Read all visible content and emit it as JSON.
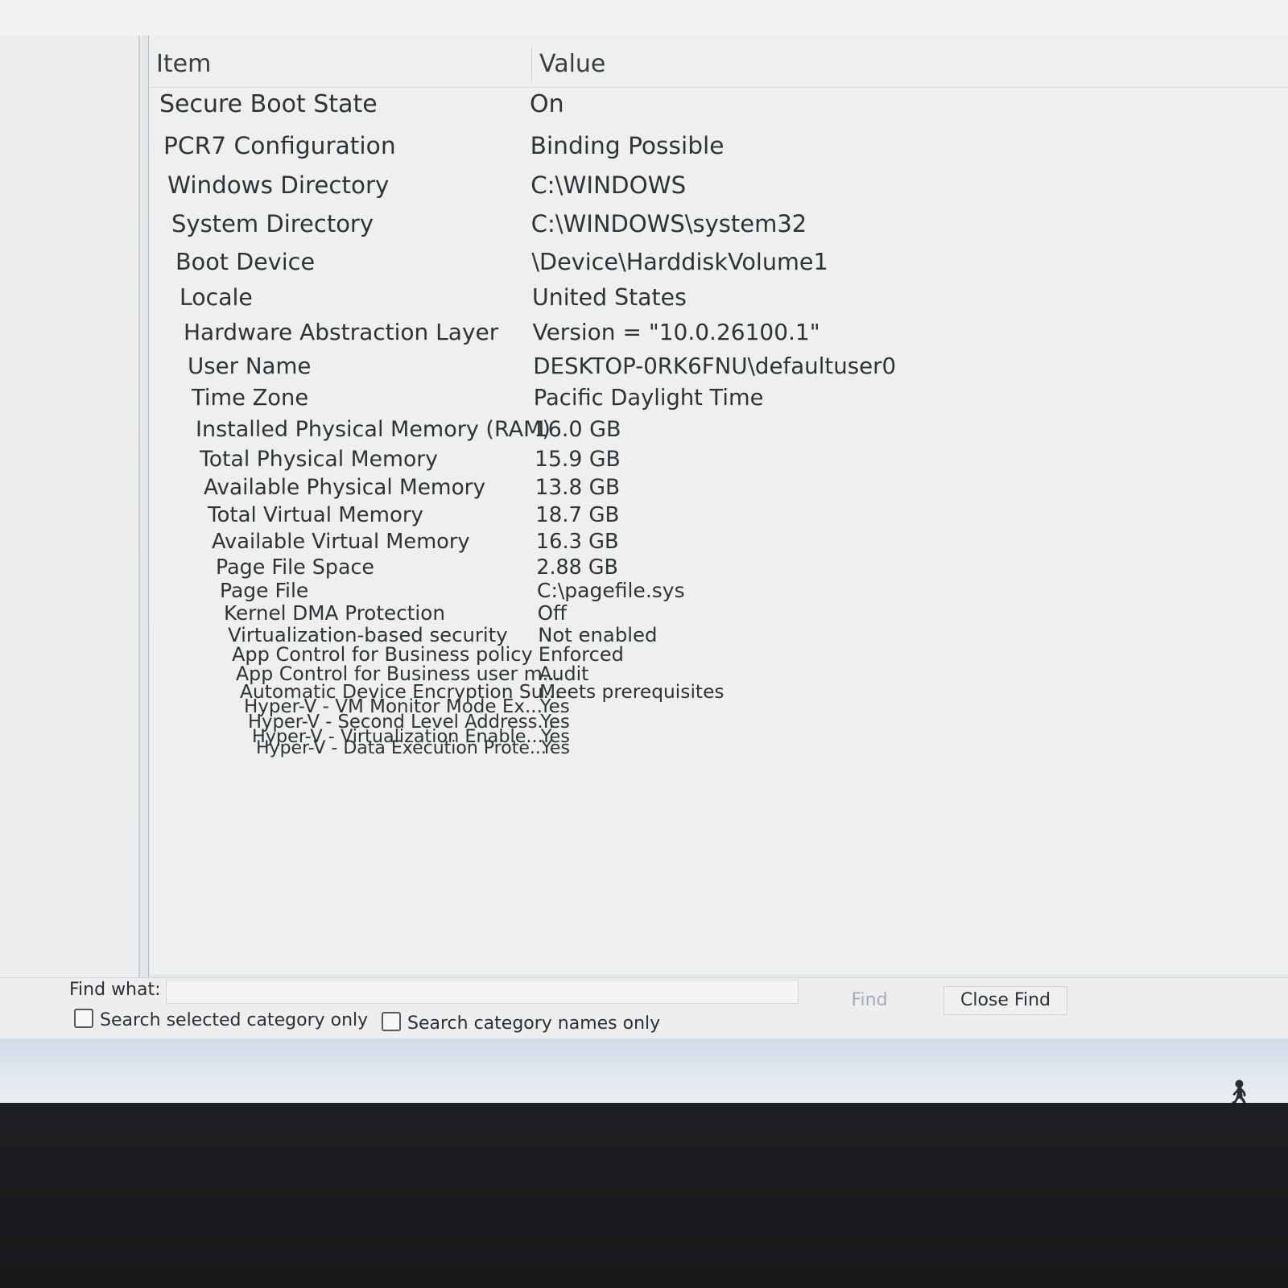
{
  "list": {
    "columns": {
      "item": "Item",
      "value": "Value"
    },
    "rows": [
      {
        "item": "Secure Boot State",
        "value": "On"
      },
      {
        "item": "PCR7 Configuration",
        "value": "Binding Possible"
      },
      {
        "item": "Windows Directory",
        "value": "C:\\WINDOWS"
      },
      {
        "item": "System Directory",
        "value": "C:\\WINDOWS\\system32"
      },
      {
        "item": "Boot Device",
        "value": "\\Device\\HarddiskVolume1"
      },
      {
        "item": "Locale",
        "value": "United States"
      },
      {
        "item": "Hardware Abstraction Layer",
        "value": "Version = \"10.0.26100.1\""
      },
      {
        "item": "User Name",
        "value": "DESKTOP-0RK6FNU\\defaultuser0"
      },
      {
        "item": "Time Zone",
        "value": "Pacific Daylight Time"
      },
      {
        "item": "Installed Physical Memory (RAM)",
        "value": "16.0 GB"
      },
      {
        "item": "Total Physical Memory",
        "value": "15.9 GB"
      },
      {
        "item": "Available Physical Memory",
        "value": "13.8 GB"
      },
      {
        "item": "Total Virtual Memory",
        "value": "18.7 GB"
      },
      {
        "item": "Available Virtual Memory",
        "value": "16.3 GB"
      },
      {
        "item": "Page File Space",
        "value": "2.88 GB"
      },
      {
        "item": "Page File",
        "value": "C:\\pagefile.sys"
      },
      {
        "item": "Kernel DMA Protection",
        "value": "Off"
      },
      {
        "item": "Virtualization-based security",
        "value": "Not enabled"
      },
      {
        "item": "App Control for Business policy",
        "value": "Enforced"
      },
      {
        "item": "App Control for Business user m...",
        "value": "Audit"
      },
      {
        "item": "Automatic Device Encryption Su...",
        "value": "Meets prerequisites"
      },
      {
        "item": "Hyper-V - VM Monitor Mode Ex...",
        "value": "Yes"
      },
      {
        "item": "Hyper-V - Second Level Address...",
        "value": "Yes"
      },
      {
        "item": "Hyper-V - Virtualization Enable...",
        "value": "Yes"
      },
      {
        "item": "Hyper-V - Data Execution Prote...",
        "value": "Yes"
      }
    ]
  },
  "find": {
    "label": "Find what:",
    "value": "",
    "find_button": "Find",
    "close_button": "Close Find",
    "checkbox_selected_category": "Search selected category only",
    "checkbox_category_names": "Search category names only"
  },
  "icons": {
    "accessibility": "accessibility-icon"
  }
}
